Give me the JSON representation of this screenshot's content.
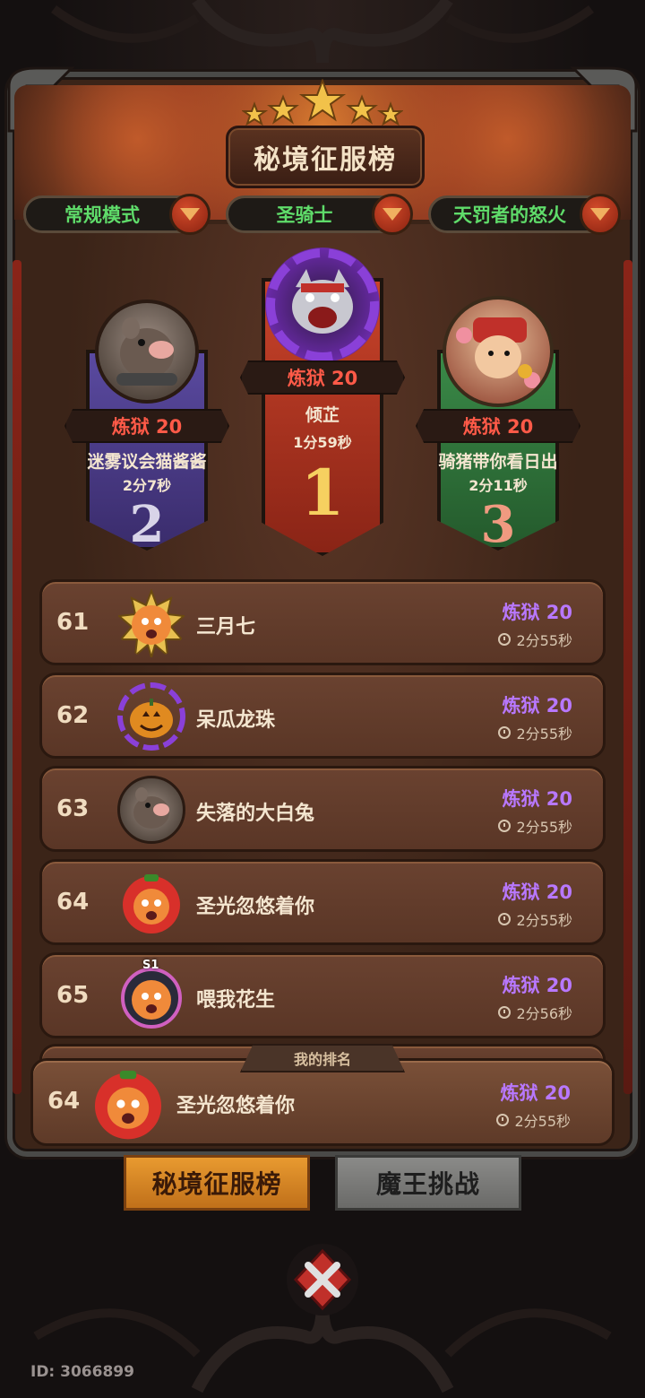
{
  "title": "秘境征服榜",
  "filters": [
    {
      "label": "常规模式"
    },
    {
      "label": "圣骑士"
    },
    {
      "label": "天罚者的怒火"
    }
  ],
  "podium": [
    {
      "rank": "1",
      "tier": "炼狱 20",
      "name": "倾芷",
      "time": "1分59秒",
      "avatar_icon": "wolf-avatar-icon",
      "color": "#b8321e"
    },
    {
      "rank": "2",
      "tier": "炼狱 20",
      "name": "迷雾议会猫酱酱",
      "time": "2分7秒",
      "avatar_icon": "rat-avatar-icon",
      "color": "#4a3a8a"
    },
    {
      "rank": "3",
      "tier": "炼狱 20",
      "name": "骑猪带你看日出",
      "time": "2分11秒",
      "avatar_icon": "hero-avatar-icon",
      "color": "#2f6a3a"
    }
  ],
  "rows": [
    {
      "rank": "61",
      "name": "三月七",
      "tier": "炼狱 20",
      "time": "2分55秒",
      "avatar_icon": "sun-tiger-avatar-icon"
    },
    {
      "rank": "62",
      "name": "呆瓜龙珠",
      "tier": "炼狱 20",
      "time": "2分55秒",
      "avatar_icon": "pumpkin-avatar-icon"
    },
    {
      "rank": "63",
      "name": "失落的大白兔",
      "tier": "炼狱 20",
      "time": "2分55秒",
      "avatar_icon": "rat-avatar-icon"
    },
    {
      "rank": "64",
      "name": "圣光忽悠着你",
      "tier": "炼狱 20",
      "time": "2分55秒",
      "avatar_icon": "tomato-tiger-avatar-icon"
    },
    {
      "rank": "65",
      "name": "喂我花生",
      "tier": "炼狱 20",
      "time": "2分56秒",
      "avatar_icon": "s1-tiger-avatar-icon",
      "badge": "S1"
    }
  ],
  "my_rank": {
    "tab_label": "我的排名",
    "rank": "64",
    "name": "圣光忽悠着你",
    "tier": "炼狱 20",
    "time": "2分55秒"
  },
  "tabs": [
    {
      "label": "秘境征服榜",
      "active": true
    },
    {
      "label": "魔王挑战",
      "active": false
    }
  ],
  "user_id": "ID: 3066899",
  "colors": {
    "tier_purple": "#b878ff",
    "tier_red": "#ff5a48",
    "filter_green": "#5fdc6a"
  }
}
